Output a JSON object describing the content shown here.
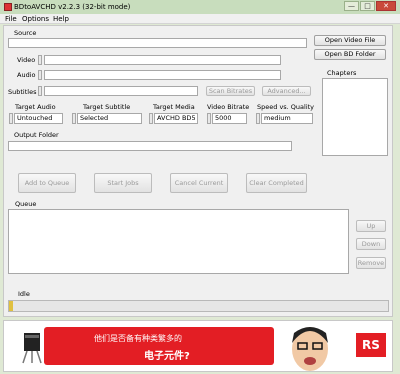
{
  "window": {
    "title": "BDtoAVCHD v2.2.3  (32-bit mode)",
    "min": "—",
    "max": "□",
    "close": "✕"
  },
  "menu": [
    "File",
    "Options",
    "Help"
  ],
  "source": {
    "label": "Source",
    "value": ""
  },
  "open_video_file": "Open Video File",
  "open_bd_folder": "Open BD Folder",
  "chapters_label": "Chapters",
  "video": {
    "label": "Video",
    "value": ""
  },
  "audio": {
    "label": "Audio",
    "value": ""
  },
  "subtitles": {
    "label": "Subtitles",
    "value": ""
  },
  "scan_bitrates": "Scan Bitrates",
  "advanced": "Advanced...",
  "targets": {
    "audio_label": "Target Audio",
    "audio_value": "Untouched",
    "subtitle_label": "Target Subtitle",
    "subtitle_value": "Selected",
    "media_label": "Target Media",
    "media_value": "AVCHD BD5",
    "bitrate_label": "Video Bitrate",
    "bitrate_value": "5000",
    "speed_label": "Speed vs. Quality",
    "speed_value": "medium"
  },
  "output_folder": {
    "label": "Output Folder",
    "value": ""
  },
  "buttons": {
    "add_to_queue": "Add to Queue",
    "start_jobs": "Start Jobs",
    "cancel_current": "Cancel Current",
    "clear_completed": "Clear Completed"
  },
  "queue_label": "Queue",
  "queue_buttons": {
    "up": "Up",
    "down": "Down",
    "remove": "Remove"
  },
  "status": "Idle",
  "progress": 0.01,
  "ad": {
    "line1": "他们是否备有种类繁多的",
    "line2": "电子元件?",
    "logo": "RS"
  }
}
